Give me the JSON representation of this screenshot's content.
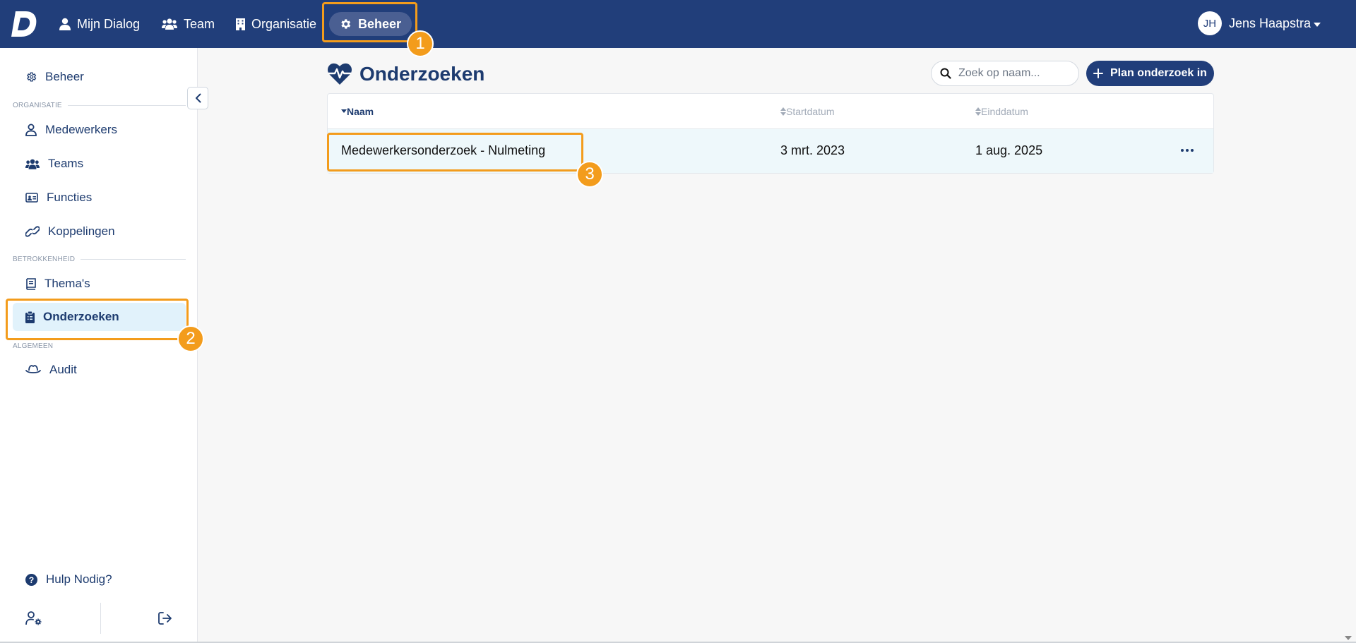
{
  "topbar": {
    "nav": [
      {
        "label": "Mijn Dialog",
        "icon": "user-icon"
      },
      {
        "label": "Team",
        "icon": "users-icon"
      },
      {
        "label": "Organisatie",
        "icon": "building-icon"
      },
      {
        "label": "Beheer",
        "icon": "gear-icon"
      }
    ],
    "user": {
      "initials": "JH",
      "name": "Jens Haapstra"
    }
  },
  "sidebar": {
    "top_item": "Beheer",
    "sections": [
      {
        "label": "ORGANISATIE",
        "items": [
          "Medewerkers",
          "Teams",
          "Functies",
          "Koppelingen"
        ]
      },
      {
        "label": "BETROKKENHEID",
        "items": [
          "Thema's",
          "Onderzoeken"
        ]
      },
      {
        "label": "ALGEMEEN",
        "items": [
          "Audit"
        ]
      }
    ],
    "help": "Hulp Nodig?"
  },
  "main": {
    "title": "Onderzoeken",
    "search_placeholder": "Zoek op naam...",
    "plan_button": "Plan onderzoek in",
    "table": {
      "columns": [
        "Naam",
        "Startdatum",
        "Einddatum"
      ],
      "rows": [
        {
          "naam": "Medewerkersonderzoek - Nulmeting",
          "start": "3 mrt. 2023",
          "eind": "1 aug. 2025"
        }
      ]
    }
  },
  "annotations": [
    "1",
    "2",
    "3"
  ],
  "colors": {
    "primary": "#213e7a",
    "accent": "#f39c1c",
    "active_bg": "#e1f2fb",
    "row_bg": "#eef8fb"
  }
}
